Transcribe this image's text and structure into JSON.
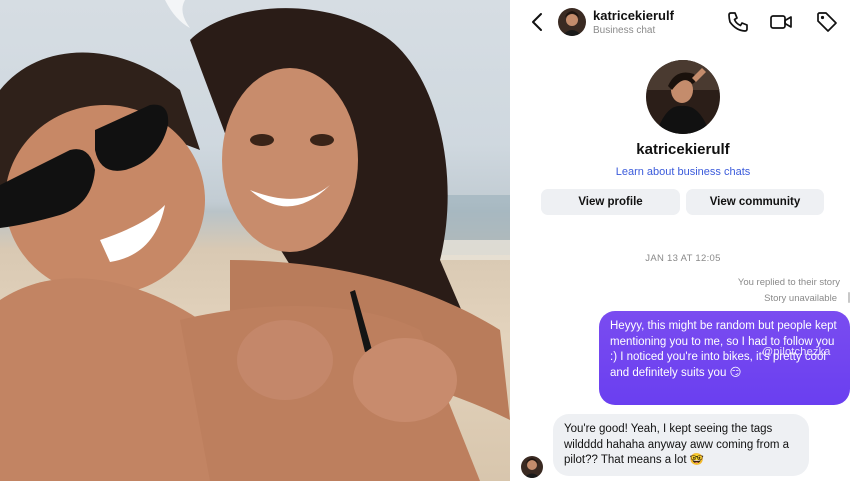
{
  "header": {
    "username": "katricekierulf",
    "subtitle": "Business chat"
  },
  "profile": {
    "name": "katricekierulf",
    "learn_link": "Learn about business chats",
    "view_profile_label": "View profile",
    "view_community_label": "View community"
  },
  "thread": {
    "timestamp": "JAN 13 AT 12:05",
    "reply_note": "You replied to their story",
    "story_status": "Story unavailable",
    "outgoing_message": "Heyyy, this might be random but people kept mentioning you to me, so I had to follow you :) I noticed you're into bikes, it's pretty cool and definitely suits you 😏",
    "incoming_message": "You're good! Yeah, I kept seeing the tags wildddd hahaha anyway aww coming from a pilot?? That means a lot 🤓",
    "watermark": "@pilotchezka"
  },
  "icons": {
    "back": "chevron-left-icon",
    "phone": "phone-icon",
    "video": "video-camera-icon",
    "tag": "tag-icon"
  },
  "colors": {
    "outgoing_bubble": "#6a3ff0",
    "incoming_bubble": "#eef0f3",
    "link": "#3b5bdb"
  }
}
